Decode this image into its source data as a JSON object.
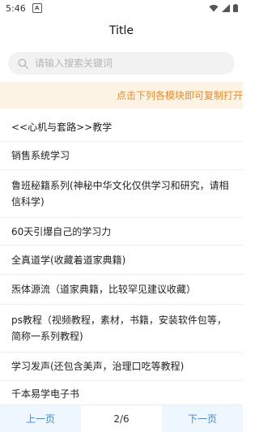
{
  "status": {
    "time": "5:46",
    "notification_badge": "A"
  },
  "header": {
    "title": "Title"
  },
  "search": {
    "placeholder": "请输入搜索关键词",
    "value": ""
  },
  "notice": {
    "text": "点击下列各模块即可复制打开"
  },
  "items": [
    {
      "label": "<<心机与套路>>教学"
    },
    {
      "label": "销售系统学习"
    },
    {
      "label": "鲁班秘籍系列(神秘中华文化仅供学习和研究，请相信科学)"
    },
    {
      "label": "60天引爆自己的学习力"
    },
    {
      "label": "全真道学(收藏着道家典籍)"
    },
    {
      "label": "炁体源流（道家典籍，比较罕见建议收藏）"
    },
    {
      "label": "ps教程（视频教程，素材，书籍，安装软件包等，简称一系列教程)"
    },
    {
      "label": "学习发声(还包含美声，治理口吃等教程)"
    },
    {
      "label": "千本易学电子书"
    }
  ],
  "pagination": {
    "prev_label": "上一页",
    "page_info": "2/6",
    "next_label": "下一页"
  },
  "colors": {
    "accent": "#3b8af0",
    "notice_text": "#f08a24",
    "notice_bg": "#fdf3e4"
  }
}
